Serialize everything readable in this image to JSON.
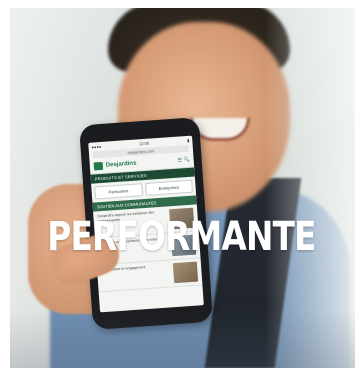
{
  "headline": "PERFORMANTE",
  "phone": {
    "url": "desjardins.com",
    "brand": "Desjardins",
    "brand_icons": "☰ 🔍",
    "section_title": "PRODUITS ET SERVICES",
    "buttons": [
      "Particuliers",
      "Entreprises"
    ],
    "card_header": "SOUTIEN AUX COMMUNAUTÉS",
    "cards": [
      "Desjardins appuie les initiatives des communautés",
      "Nouvelles et événements dans votre région",
      "Coopérative et engagement"
    ]
  },
  "colors": {
    "brand_green": "#1f7a47",
    "headline_text": "#ffffff"
  }
}
